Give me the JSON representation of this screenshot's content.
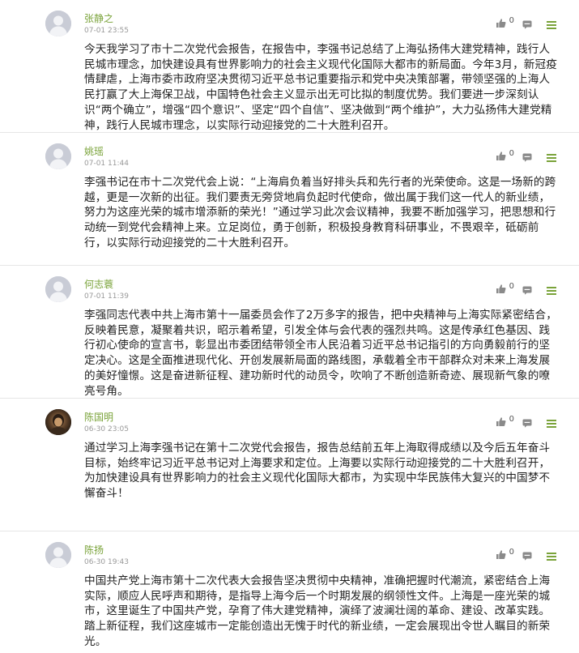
{
  "comments": [
    {
      "user": "张静之",
      "time": "07-01 23:55",
      "likes": "0",
      "avatar": "default-avatar",
      "text": "今天我学习了市十二次党代会报告，在报告中，李强书记总结了上海弘扬伟大建党精神，践行人民城市理念，加快建设具有世界影响力的社会主义现代化国际大都市的新局面。今年3月，新冠疫情肆虐，上海市委市政府坚决贯彻习近平总书记重要指示和党中央决策部署，带领坚强的上海人民打赢了大上海保卫战，中国特色社会主义显示出无可比拟的制度优势。我们要进一步深刻认识“两个确立”，增强“四个意识”、坚定“四个自信”、坚决做到“两个维护”，大力弘扬伟大建党精神，践行人民城市理念，以实际行动迎接党的二十大胜利召开。"
    },
    {
      "user": "姚瑶",
      "time": "07-01 11:44",
      "likes": "0",
      "avatar": "default-avatar",
      "text": "李强书记在市十二次党代会上说：“上海肩负着当好排头兵和先行者的光荣使命。这是一场新的跨越，更是一次新的出征。我们要责无旁贷地肩负起时代使命，做出属于我们这一代人的新业绩，努力为这座光荣的城市增添新的荣光！”通过学习此次会议精神，我要不断加强学习，把思想和行动统一到党代会精神上来。立足岗位，勇于创新，积极投身教育科研事业，不畏艰辛，砥砺前行，以实际行动迎接党的二十大胜利召开。"
    },
    {
      "user": "何志蓑",
      "time": "07-01 11:39",
      "likes": "0",
      "avatar": "default-avatar",
      "text": "李强同志代表中共上海市第十一届委员会作了2万多字的报告，把中央精神与上海实际紧密结合，反映着民意，凝聚着共识，昭示着希望，引发全体与会代表的强烈共鸣。这是传承红色基因、践行初心使命的宣言书，彰显出市委团结带领全市人民沿着习近平总书记指引的方向勇毅前行的坚定决心。这是全面推进现代化、开创发展新局面的路线图，承载着全市干部群众对未来上海发展的美好憧憬。这是奋进新征程、建功新时代的动员令，吹响了不断创造新奇迹、展现新气象的嘹亮号角。"
    },
    {
      "user": "陈国明",
      "time": "06-30 23:05",
      "likes": "0",
      "avatar": "photo-avatar",
      "text": "通过学习上海李强书记在第十二次党代会报告，报告总结前五年上海取得成绩以及今后五年奋斗目标，始终牢记习近平总书记对上海要求和定位。上海要以实际行动迎接党的二十大胜利召开，为加快建设具有世界影响力的社会主义现代化国际大都市，为实现中华民族伟大复兴的中国梦不懈奋斗！"
    },
    {
      "user": "陈扬",
      "time": "06-30 19:43",
      "likes": "0",
      "avatar": "default-avatar",
      "text": "中国共产党上海市第十二次代表大会报告坚决贯彻中央精神，准确把握时代潮流，紧密结合上海实际，顺应人民呼声和期待，是指导上海今后一个时期发展的纲领性文件。上海是一座光荣的城市，这里诞生了中国共产党，孕育了伟大建党精神，演绎了波澜壮阔的革命、建设、改革实践。踏上新征程，我们这座城市一定能创造出无愧于时代的新业绩，一定会展现出令世人瞩目的新荣光。"
    }
  ]
}
